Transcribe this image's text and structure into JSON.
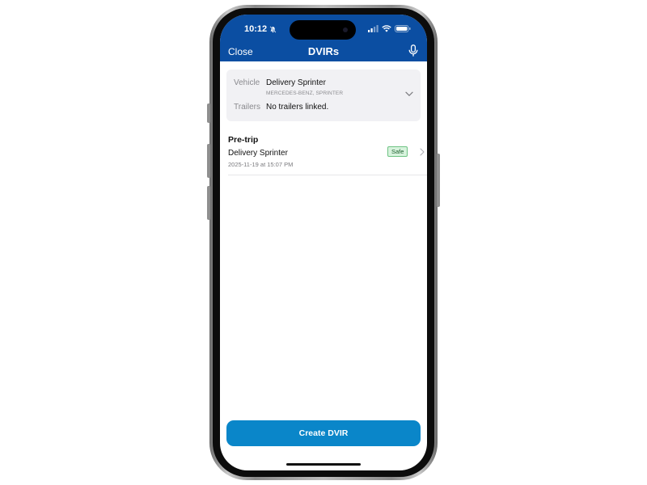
{
  "status_bar": {
    "time": "10:12",
    "icons": [
      "bell-slash-icon",
      "signal-icon",
      "wifi-icon",
      "battery-icon"
    ]
  },
  "nav": {
    "close_label": "Close",
    "title": "DVIRs",
    "mic_icon": "microphone-icon"
  },
  "vehicle_card": {
    "vehicle_label": "Vehicle",
    "vehicle_name": "Delivery Sprinter",
    "vehicle_sub": "MERCEDES-BENZ, SPRINTER",
    "trailers_label": "Trailers",
    "trailers_value": "No trailers linked."
  },
  "dvirs": [
    {
      "type": "Pre-trip",
      "vehicle": "Delivery Sprinter",
      "datetime": "2025-11-19 at 15:07 PM",
      "status": "Safe"
    }
  ],
  "create_button": {
    "label": "Create DVIR"
  },
  "colors": {
    "header": "#0b4ea2",
    "button": "#0a86c9",
    "safe_badge_bg": "#d7f3dd",
    "safe_badge_border": "#6fc384"
  }
}
